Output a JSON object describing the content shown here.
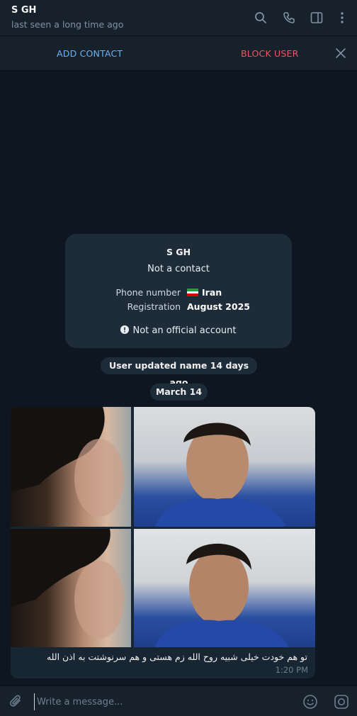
{
  "header": {
    "name": "S GH",
    "status": "last seen a long time ago",
    "icons": [
      "search-icon",
      "phone-icon",
      "sidebar-icon",
      "more-vertical-icon"
    ]
  },
  "action_bar": {
    "add_contact": "ADD CONTACT",
    "block_user": "BLOCK USER",
    "close_icon": "close-icon"
  },
  "info_card": {
    "name": "S GH",
    "subtitle": "Not a contact",
    "phone_label": "Phone number",
    "phone_value": "Iran",
    "registration_label": "Registration",
    "registration_value": "August 2025",
    "warning": "Not an official account",
    "warning_icon": "exclamation-circle-icon"
  },
  "service_message": "User updated name 14 days ago",
  "date_separator": "March 14",
  "message": {
    "caption": "تو هم خودت خیلی شبیه روح الله زم هستی و هم سرنوشتت به اذن الله",
    "time": "1:20 PM"
  },
  "composer": {
    "placeholder": "Write a message...",
    "icons": [
      "attach-icon",
      "emoji-icon",
      "instagram-like-icon"
    ]
  },
  "colors": {
    "background": "#0e1621",
    "panel": "#17212b",
    "bubble": "#182533",
    "accent": "#6ab3f3",
    "danger": "#e9585f"
  }
}
